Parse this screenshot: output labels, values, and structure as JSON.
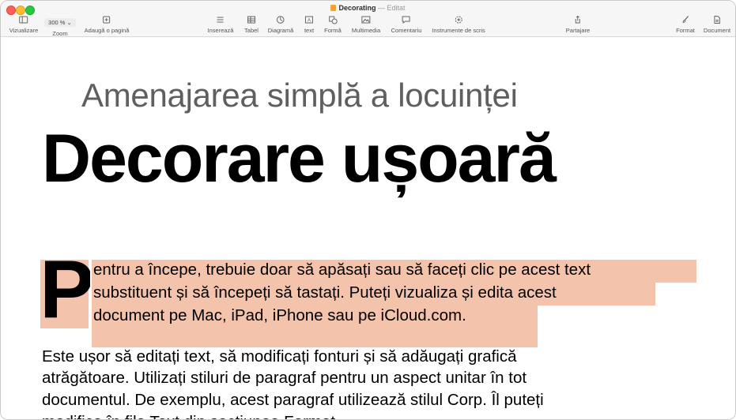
{
  "window": {
    "document_name": "Decorating",
    "status": "— Editat"
  },
  "toolbar": {
    "left": [
      {
        "id": "view",
        "label": "Vizualizare",
        "icon": "sidebar-icon"
      },
      {
        "id": "zoom",
        "label": "Zoom",
        "value": "300 %",
        "icon": "chevron-down-icon"
      },
      {
        "id": "add-page",
        "label": "Adaugă o pagină",
        "icon": "plus-square-icon"
      }
    ],
    "center": [
      {
        "id": "insert",
        "label": "Inserează",
        "icon": "list-icon"
      },
      {
        "id": "table",
        "label": "Tabel",
        "icon": "table-icon"
      },
      {
        "id": "chart",
        "label": "Diagramă",
        "icon": "clock-chart-icon"
      },
      {
        "id": "text",
        "label": "text",
        "icon": "text-box-icon"
      },
      {
        "id": "shape",
        "label": "Formă",
        "icon": "shape-icon"
      },
      {
        "id": "media",
        "label": "Multimedia",
        "icon": "image-icon"
      },
      {
        "id": "comment",
        "label": "Comentariu",
        "icon": "speech-bubble-icon"
      },
      {
        "id": "writing-tools",
        "label": "Instrumente de scris",
        "icon": "sparkle-icon"
      }
    ],
    "share": {
      "label": "Partajare",
      "icon": "share-icon"
    },
    "right": [
      {
        "id": "format",
        "label": "Format",
        "icon": "paintbrush-icon"
      },
      {
        "id": "document",
        "label": "Document",
        "icon": "document-icon"
      }
    ]
  },
  "content": {
    "subtitle": "Amenajarea simplă a locuinței",
    "title": "Decorare ușoară",
    "drop_cap": "P",
    "intro_lines": [
      "entru a începe, trebuie doar să apăsați sau să faceți clic pe acest text",
      "substituent și să începeți să tastați. Puteți vizualiza și edita acest",
      "document pe Mac, iPad, iPhone sau pe iCloud.com."
    ],
    "body_lines": [
      "Este ușor să editați text, să modificați fonturi și să adăugați grafică",
      "atrăgătoare. Utilizați stiluri de paragraf pentru un aspect unitar în tot",
      "documentul. De exemplu, acest paragraf utilizează stilul Corp. Îl puteți",
      "modifica în fila Text din secțiunea Format."
    ],
    "highlight_color": "#f4c3ac"
  }
}
